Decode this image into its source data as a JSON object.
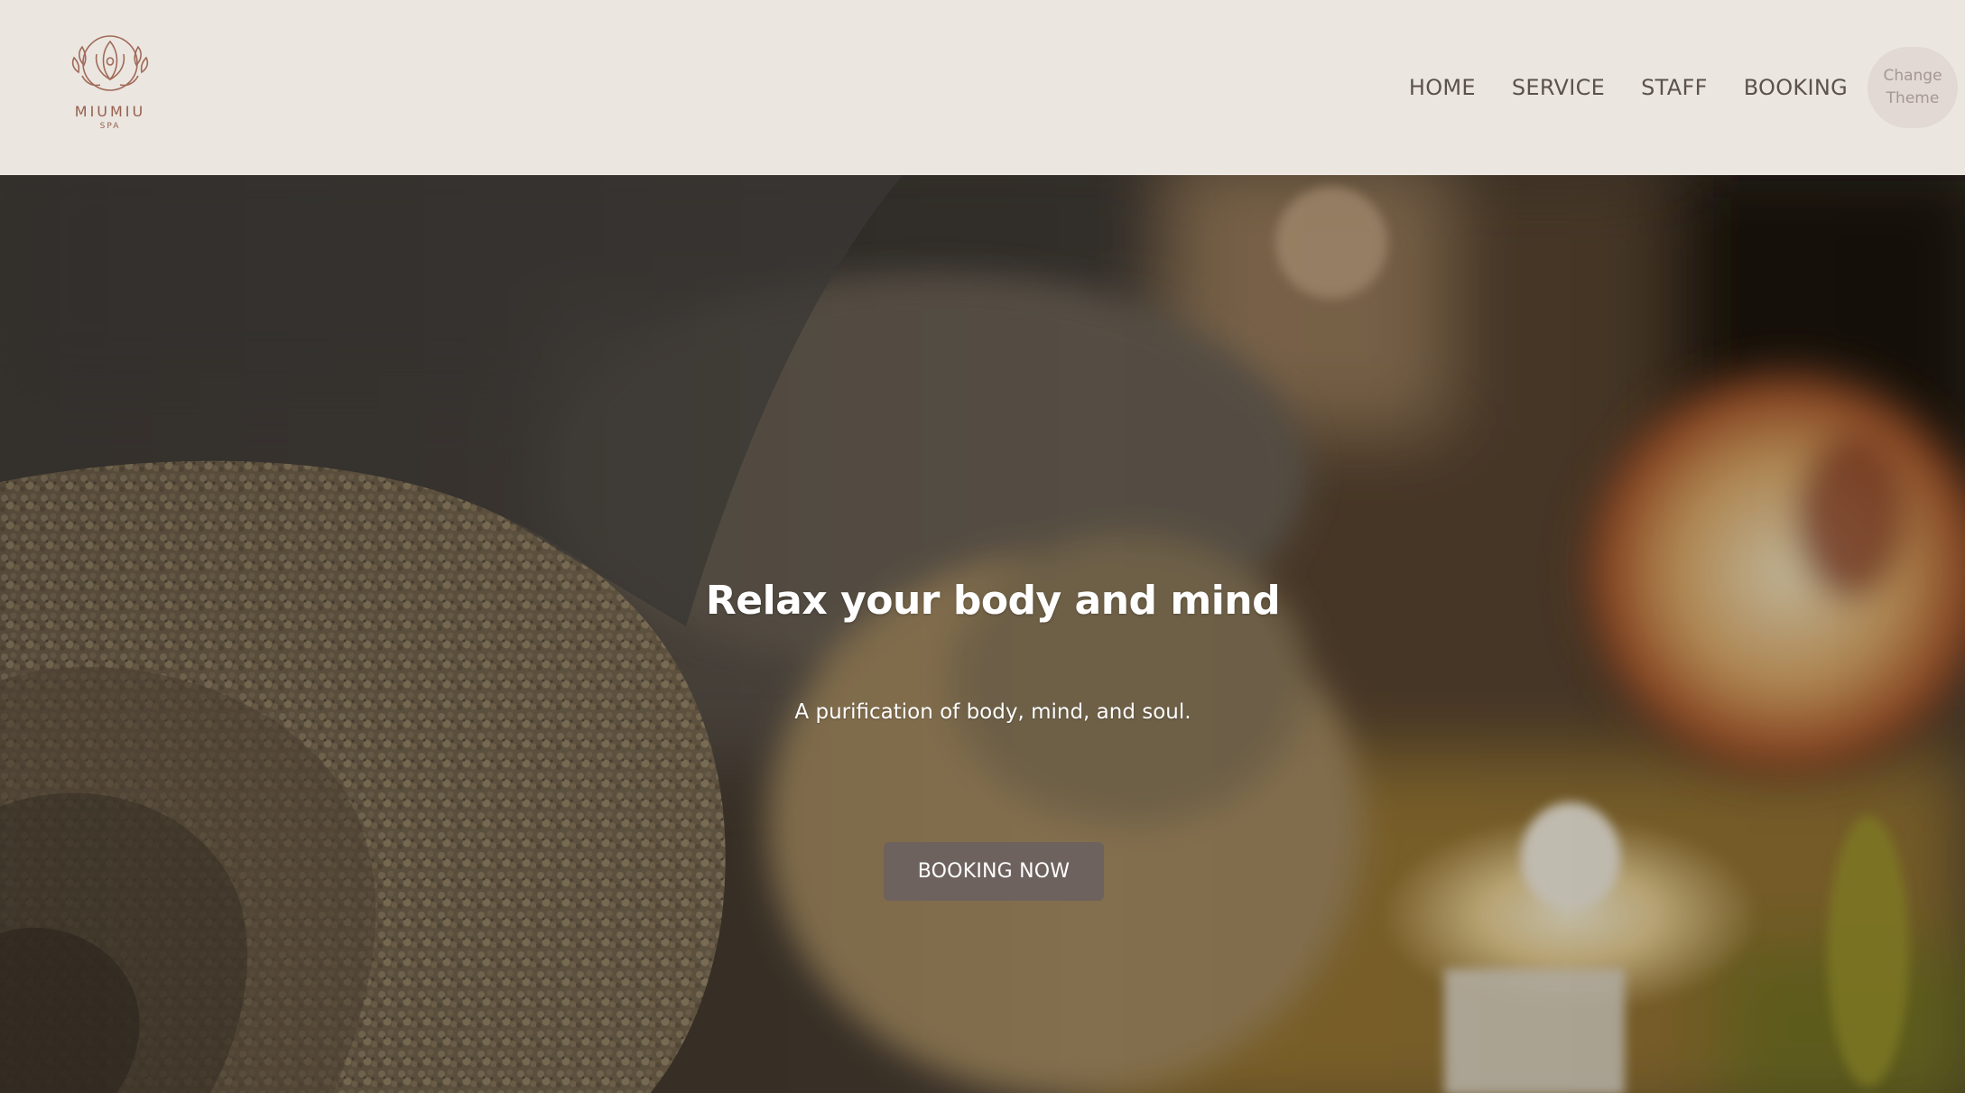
{
  "brand": {
    "name": "MIUMIU",
    "tagline": "SPA",
    "logo_icon": "lotus-leaves-icon",
    "color": "#a06a58"
  },
  "nav": {
    "items": [
      {
        "label": "HOME"
      },
      {
        "label": "SERVICE"
      },
      {
        "label": "STAFF"
      },
      {
        "label": "BOOKING"
      }
    ],
    "theme_button": {
      "line1": "Change",
      "line2": "Theme"
    }
  },
  "hero": {
    "title": "Relax your body and mind",
    "subtitle": "A purification of body, mind, and soul.",
    "cta_label": "BOOKING NOW",
    "background": "blurred-towel-candle-photo"
  },
  "colors": {
    "header_bg": "#ebe6e0",
    "nav_text": "#5c514d",
    "theme_button_bg": "#e2d8d4",
    "cta_bg": "#6e625e"
  }
}
